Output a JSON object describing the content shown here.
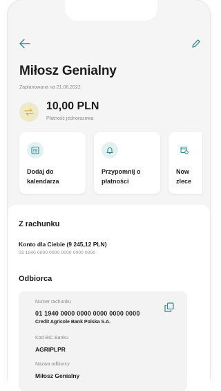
{
  "header": {
    "back_icon": "arrow-left-icon",
    "edit_icon": "pencil-icon",
    "accent_color": "#2a8c93"
  },
  "payment": {
    "recipient_title": "Miłosz Genialny",
    "planned_label": "Zaplanowana na 21.06.2022",
    "amount": "10,00 PLN",
    "type": "Płatność jednorazowa",
    "icon": "transfer-icon"
  },
  "actions": [
    {
      "label": "Dodaj do\nkalendarza",
      "icon": "calendar-icon"
    },
    {
      "label": "Przypomnij o\npłatności",
      "icon": "bell-icon"
    },
    {
      "label": "Now\nzlece",
      "icon": "repeat-calendar-icon"
    }
  ],
  "from_account": {
    "heading": "Z rachunku",
    "name": "Konto dla Ciebie (9 245,12 PLN)",
    "number": "03 1940 0000 0000 0000 0000 0000"
  },
  "recipient": {
    "heading": "Odbiorca",
    "account_label": "Numer rachunku",
    "account_number": "01 1940 0000 0000 0000 0000 0000",
    "bank_name": "Credit Agricole Bank Polska S.A.",
    "bic_label": "Kod BIC Banku",
    "bic": "AGRIPLPR",
    "name_label": "Nazwa odbiorcy",
    "name": "Miłosz Genialny",
    "copy_icon": "copy-icon"
  }
}
